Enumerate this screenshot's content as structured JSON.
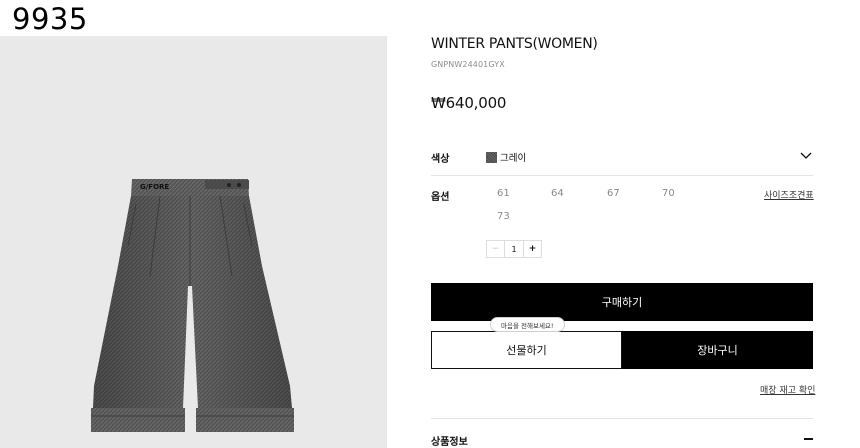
{
  "overlay_id": "9935",
  "product": {
    "title": "WINTER PANTS(WOMEN)",
    "code": "GNPNW24401GYX",
    "price": "₩640,000",
    "image_logo_text": "G/FORE"
  },
  "color_row": {
    "label": "색상",
    "value": "그레이",
    "swatch_color": "#555555",
    "dropdown_icon": "chevron-down-icon"
  },
  "option_row": {
    "label": "옵션",
    "sizes": [
      "61",
      "64",
      "67",
      "70",
      "73"
    ],
    "size_chart_link": "사이즈조견표"
  },
  "quantity": {
    "minus": "−",
    "value": "1",
    "plus": "+"
  },
  "buttons": {
    "buy": "구매하기",
    "gift": "선물하기",
    "cart": "장바구니",
    "gift_tooltip": "마음을 전해보세요!"
  },
  "stock_link": "매장 재고 확인",
  "detail_section": {
    "label": "상품정보",
    "toggle_icon": "minus-icon"
  }
}
